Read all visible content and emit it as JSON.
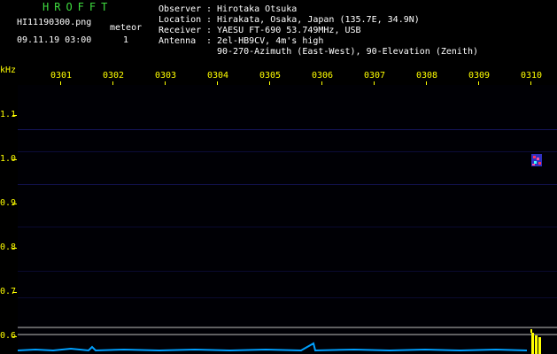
{
  "app": {
    "logo": "HROFFT",
    "filename": "HI11190300.png",
    "datetime": "09.11.19 03:00",
    "meteor_label": "meteor",
    "meteor_count": "1"
  },
  "info": {
    "observer_label": "Observer",
    "observer": "Hirotaka Otsuka",
    "location_label": "Location",
    "location": "Hirakata, Osaka, Japan (135.7E, 34.9N)",
    "receiver_label": "Receiver",
    "receiver": "YAESU FT-690 53.749MHz, USB",
    "antenna_label": "Antenna",
    "antenna_line1": "2el-HB9CV, 4m's high",
    "antenna_line2": "90-270-Azimuth (East-West), 90-Elevation (Zenith)"
  },
  "axes": {
    "y_unit": "kHz",
    "x_ticks": [
      "0301",
      "0302",
      "0303",
      "0304",
      "0305",
      "0306",
      "0307",
      "0308",
      "0309",
      "0310"
    ],
    "y_ticks": [
      "1.1",
      "1.0",
      "0.9",
      "0.8",
      "0.7",
      "0.6"
    ]
  },
  "colors": {
    "logo": "#3fdc3f",
    "labels": "#ffff00",
    "text": "#ffffff",
    "background": "#000000",
    "trace": "#00a0ff"
  }
}
